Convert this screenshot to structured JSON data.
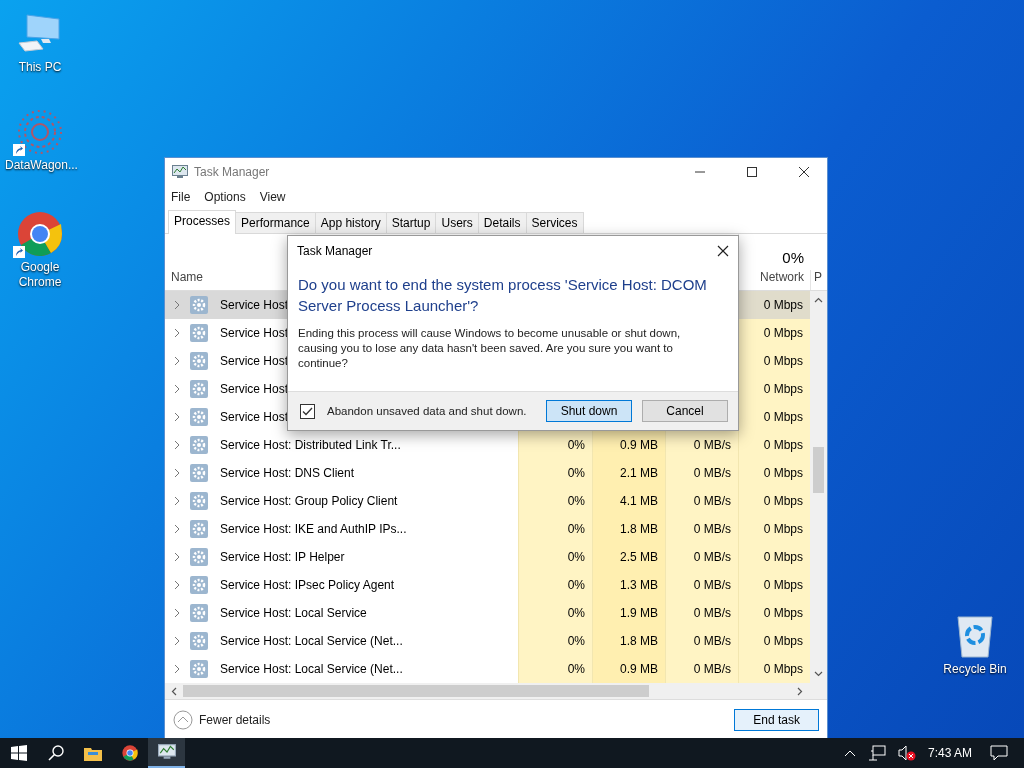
{
  "desktop_icons": [
    {
      "kind": "computer",
      "label": "This PC",
      "shortcut": false
    },
    {
      "kind": "datawagon",
      "label": "DataWagon...",
      "shortcut": true
    },
    {
      "kind": "chrome",
      "label": "Google Chrome",
      "shortcut": true
    },
    {
      "kind": "recycle",
      "label": "Recycle Bin",
      "shortcut": false
    }
  ],
  "window": {
    "title": "Task Manager",
    "menu": [
      "File",
      "Options",
      "View"
    ],
    "tabs": [
      {
        "label": "Processes",
        "selected": true
      },
      {
        "label": "Performance",
        "selected": false
      },
      {
        "label": "App history",
        "selected": false
      },
      {
        "label": "Startup",
        "selected": false
      },
      {
        "label": "Users",
        "selected": false
      },
      {
        "label": "Details",
        "selected": false
      },
      {
        "label": "Services",
        "selected": false
      }
    ],
    "header": {
      "name": "Name",
      "network_percent": "0%",
      "network": "Network",
      "column_7": "P"
    },
    "rows": [
      {
        "name": "Service Host",
        "network": "0 Mbps",
        "selected": true
      },
      {
        "name": "Service Host",
        "network": "0 Mbps",
        "selected": false
      },
      {
        "name": "Service Host",
        "network": "0 Mbps",
        "selected": false
      },
      {
        "name": "Service Host",
        "network": "0 Mbps",
        "selected": false
      },
      {
        "name": "Service Host",
        "network": "0 Mbps",
        "selected": false
      },
      {
        "name": "Service Host: Distributed Link Tr...",
        "cpu": "0%",
        "memory": "0.9 MB",
        "disk": "0 MB/s",
        "network": "0 Mbps",
        "selected": false
      },
      {
        "name": "Service Host: DNS Client",
        "cpu": "0%",
        "memory": "2.1 MB",
        "disk": "0 MB/s",
        "network": "0 Mbps",
        "selected": false
      },
      {
        "name": "Service Host: Group Policy Client",
        "cpu": "0%",
        "memory": "4.1 MB",
        "disk": "0 MB/s",
        "network": "0 Mbps",
        "selected": false
      },
      {
        "name": "Service Host: IKE and AuthIP IPs...",
        "cpu": "0%",
        "memory": "1.8 MB",
        "disk": "0 MB/s",
        "network": "0 Mbps",
        "selected": false
      },
      {
        "name": "Service Host: IP Helper",
        "cpu": "0%",
        "memory": "2.5 MB",
        "disk": "0 MB/s",
        "network": "0 Mbps",
        "selected": false
      },
      {
        "name": "Service Host: IPsec Policy Agent",
        "cpu": "0%",
        "memory": "1.3 MB",
        "disk": "0 MB/s",
        "network": "0 Mbps",
        "selected": false
      },
      {
        "name": "Service Host: Local Service",
        "cpu": "0%",
        "memory": "1.9 MB",
        "disk": "0 MB/s",
        "network": "0 Mbps",
        "selected": false
      },
      {
        "name": "Service Host: Local Service (Net...",
        "cpu": "0%",
        "memory": "1.8 MB",
        "disk": "0 MB/s",
        "network": "0 Mbps",
        "selected": false
      },
      {
        "name": "Service Host: Local Service (Net...",
        "cpu": "0%",
        "memory": "0.9 MB",
        "disk": "0 MB/s",
        "network": "0 Mbps",
        "selected": false
      }
    ],
    "footer": {
      "fewer_details": "Fewer details",
      "end_task": "End task"
    }
  },
  "dialog": {
    "title": "Task Manager",
    "heading": "Do you want to end the system process 'Service Host: DCOM Server Process Launcher'?",
    "body": "Ending this process will cause Windows to become unusable or shut down, causing you to lose any data hasn't been saved. Are you sure you want to continue?",
    "checkbox": {
      "label": "Abandon unsaved data and shut down.",
      "checked": true
    },
    "buttons": [
      {
        "label": "Shut down",
        "default": true
      },
      {
        "label": "Cancel",
        "default": false
      }
    ]
  },
  "taskbar": {
    "apps": [
      {
        "kind": "start",
        "selected": false
      },
      {
        "kind": "search",
        "selected": false
      },
      {
        "kind": "explorer",
        "selected": false
      },
      {
        "kind": "chrome",
        "selected": false
      },
      {
        "kind": "taskmanager",
        "selected": true
      }
    ],
    "volume_muted": true,
    "time": "7:43 AM"
  }
}
